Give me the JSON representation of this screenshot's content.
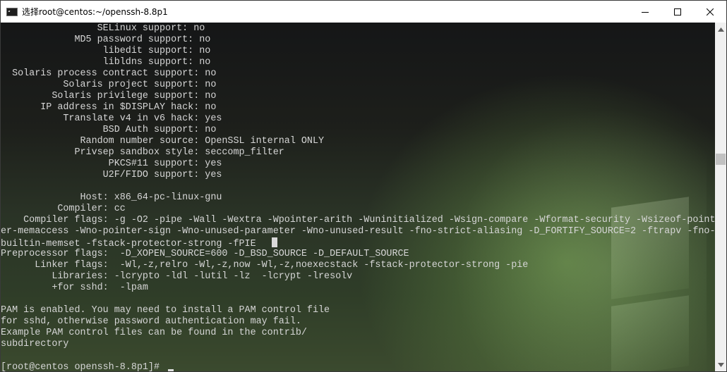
{
  "window": {
    "title": "选择root@centos:~/openssh-8.8p1",
    "icon": "terminal-icon"
  },
  "controls": {
    "minimize": "minimize-icon",
    "maximize": "maximize-icon",
    "close": "close-icon"
  },
  "terminal": {
    "lines": [
      "                 SELinux support: no",
      "             MD5 password support: no",
      "                  libedit support: no",
      "                  libldns support: no",
      "  Solaris process contract support: no",
      "           Solaris project support: no",
      "         Solaris privilege support: no",
      "       IP address in $DISPLAY hack: no",
      "           Translate v4 in v6 hack: yes",
      "                  BSD Auth support: no",
      "              Random number source: OpenSSL internal ONLY",
      "             Privsep sandbox style: seccomp_filter",
      "                   PKCS#11 support: yes",
      "                  U2F/FIDO support: yes",
      "",
      "              Host: x86_64-pc-linux-gnu",
      "          Compiler: cc",
      "    Compiler flags: -g -O2 -pipe -Wall -Wextra -Wpointer-arith -Wuninitialized -Wsign-compare -Wformat-security -Wsizeof-point",
      "er-memaccess -Wno-pointer-sign -Wno-unused-parameter -Wno-unused-result -fno-strict-aliasing -D_FORTIFY_SOURCE=2 -ftrapv -fno-",
      "builtin-memset -fstack-protector-strong -fPIE",
      "Preprocessor flags:  -D_XOPEN_SOURCE=600 -D_BSD_SOURCE -D_DEFAULT_SOURCE",
      "      Linker flags:  -Wl,-z,relro -Wl,-z,now -Wl,-z,noexecstack -fstack-protector-strong -pie",
      "         Libraries: -lcrypto -ldl -lutil -lz  -lcrypt -lresolv",
      "         +for sshd:  -lpam",
      "",
      "PAM is enabled. You may need to install a PAM control file",
      "for sshd, otherwise password authentication may fail.",
      "Example PAM control files can be found in the contrib/",
      "subdirectory"
    ],
    "prompt": "[root@centos openssh-8.8p1]# "
  },
  "scrollbar": {
    "up": "scroll-up-arrow-icon",
    "down": "scroll-down-arrow-icon"
  }
}
